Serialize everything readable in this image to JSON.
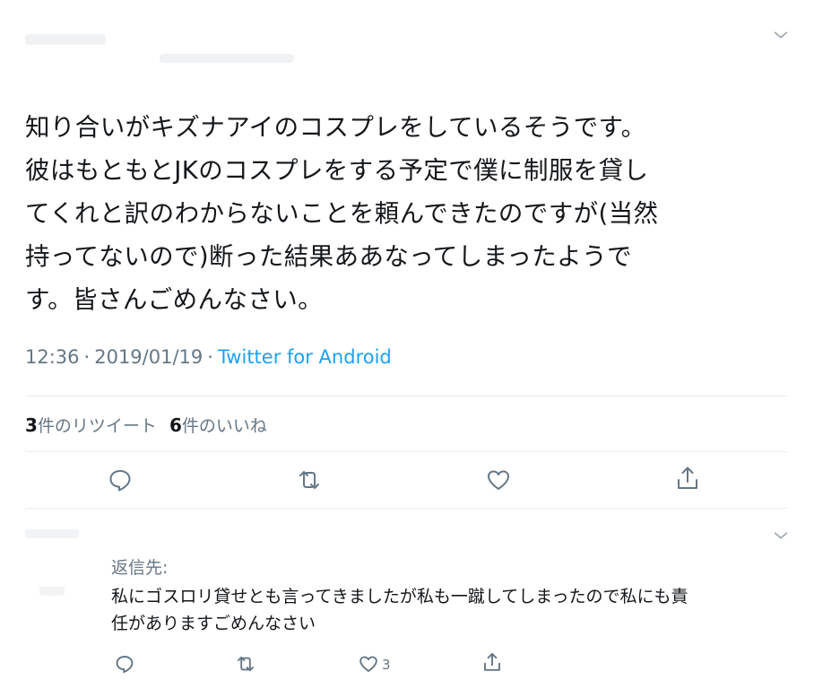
{
  "tweet": {
    "text": "知り合いがキズナアイのコスプレをしているそうです。\n彼はもともとJKのコスプレをする予定で僕に制服を貸し\nてくれと訳のわからないことを頼んできたのですが(当然\n持ってないので)断った結果ああなってしまったようで\nす。皆さんごめんなさい。",
    "time": "12:36",
    "date": "2019/01/19",
    "separator": "·",
    "source": "Twitter for Android"
  },
  "stats": {
    "retweets_count": "3",
    "retweets_label": "件のリツイート",
    "likes_count": "6",
    "likes_label": "件のいいね"
  },
  "reply": {
    "reply_to_label": "返信先:",
    "text": "私にゴスロリ貸せとも言ってきましたが私も一蹴してしまったので私にも責\n任がありますごめんなさい",
    "like_count": "3"
  },
  "icons": {
    "caret": "chevron-down-icon",
    "reply": "comment-icon",
    "retweet": "retweet-icon",
    "like": "heart-icon",
    "share": "share-icon"
  },
  "colors": {
    "text": "#14171a",
    "muted": "#657786",
    "link": "#1da1f2",
    "divider": "#e6ecf0"
  }
}
